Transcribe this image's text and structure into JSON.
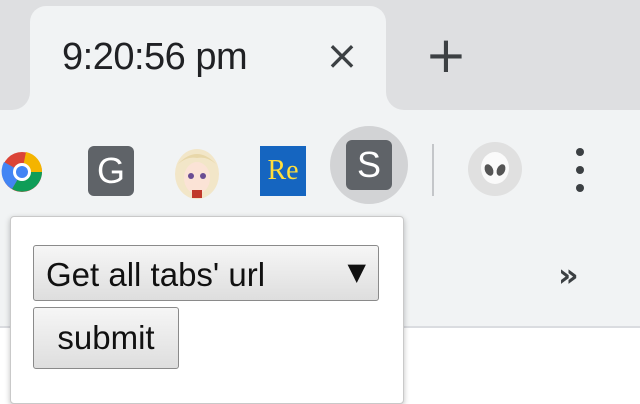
{
  "tab": {
    "title": "9:20:56 pm",
    "close_icon": "close-icon",
    "new_tab_icon": "plus-icon"
  },
  "toolbar": {
    "extensions": [
      {
        "name": "chrome-extension-icon"
      },
      {
        "name": "g-extension-icon",
        "label": "G"
      },
      {
        "name": "anime-avatar-extension-icon"
      },
      {
        "name": "re-extension-icon",
        "label": "Re"
      },
      {
        "name": "s-extension-icon",
        "label": "S"
      }
    ],
    "profile_icon": "alien-avatar-icon",
    "menu_icon": "three-dots-menu-icon"
  },
  "bookmarks": {
    "overflow_label": "»"
  },
  "popup": {
    "select_value": "Get all tabs' url",
    "select_arrow": "▼",
    "submit_label": "submit"
  }
}
